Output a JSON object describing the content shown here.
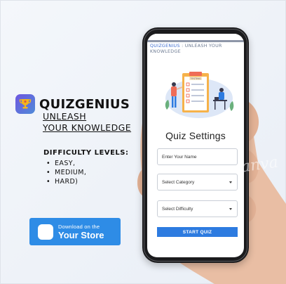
{
  "brand": {
    "name": "QUIZGENIUS",
    "tagline_line1": "UNLEASH",
    "tagline_line2": "YOUR KNOWLEDGE"
  },
  "difficulty": {
    "title": "DIFFICULTY LEVELS:",
    "items": [
      "EASY,",
      "MEDIUM,",
      "HARD)"
    ]
  },
  "store_button": {
    "small_label": "Download on the",
    "big_label": "Your Store"
  },
  "app": {
    "header_brand": "QUIZGENIUS",
    "header_rest": " : UNLEASH YOUR KNOWLEDGE",
    "illustration_label": "TESTING",
    "settings_title": "Quiz Settings",
    "name_placeholder": "Enter Your Name",
    "category_label": "Select Category",
    "difficulty_label": "Select Difficulty",
    "start_label": "START QUIZ"
  },
  "watermark": "anva",
  "colors": {
    "accent_blue": "#2d7be0",
    "store_blue": "#2e8ce6",
    "logo_purple": "#6f56e0",
    "trophy_gold": "#f3b51c"
  }
}
